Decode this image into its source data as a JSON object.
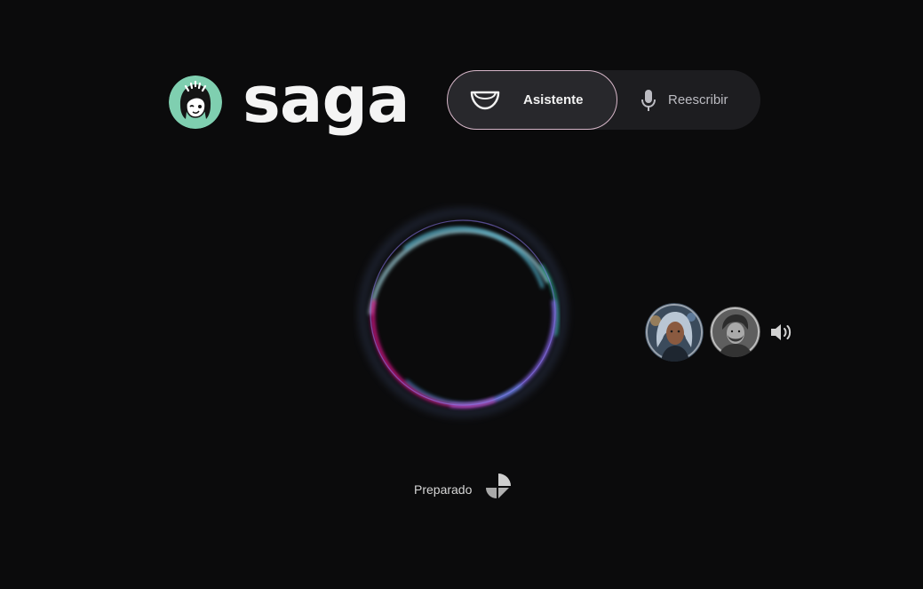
{
  "brand": {
    "name": "saga",
    "logo_icon": "saga-mascot-avatar-icon",
    "logo_color": "#7fcfb0"
  },
  "modes": [
    {
      "label": "Asistente",
      "icon": "smile-mouth-icon",
      "active": true
    },
    {
      "label": "Reescribir",
      "icon": "microphone-icon",
      "active": false
    }
  ],
  "orb": {
    "icon": "voice-orb-ring",
    "colors": [
      "#9ad6e8",
      "#e0148c",
      "#7a5cf0",
      "#32c8b0"
    ]
  },
  "voices": [
    {
      "icon": "voice-avatar-woman-icon",
      "selected": true
    },
    {
      "icon": "voice-avatar-man-icon",
      "selected": false
    }
  ],
  "speaker": {
    "icon": "speaker-volume-icon"
  },
  "status": {
    "text": "Preparado",
    "icon": "pie-status-icon"
  },
  "colors": {
    "background": "#0b0b0c",
    "toggle_bg": "#1d1d20",
    "active_border": "#d7b7c9"
  }
}
